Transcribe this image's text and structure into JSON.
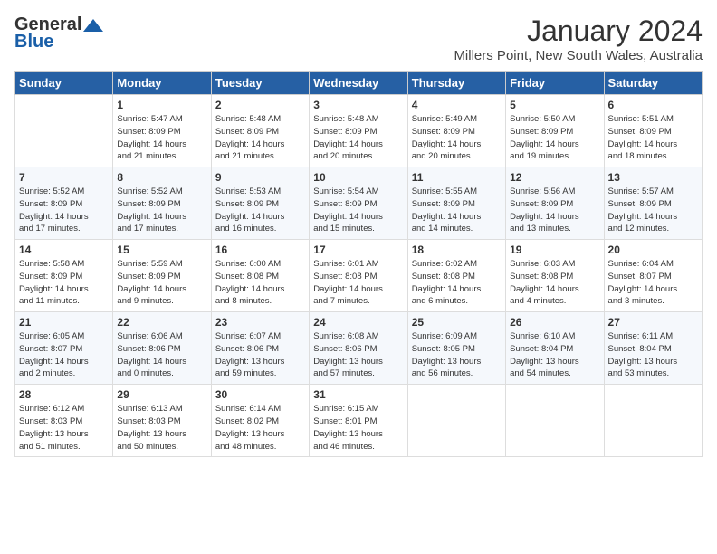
{
  "header": {
    "logo_general": "General",
    "logo_blue": "Blue",
    "title": "January 2024",
    "location": "Millers Point, New South Wales, Australia"
  },
  "days_of_week": [
    "Sunday",
    "Monday",
    "Tuesday",
    "Wednesday",
    "Thursday",
    "Friday",
    "Saturday"
  ],
  "weeks": [
    [
      {
        "num": "",
        "info": ""
      },
      {
        "num": "1",
        "info": "Sunrise: 5:47 AM\nSunset: 8:09 PM\nDaylight: 14 hours\nand 21 minutes."
      },
      {
        "num": "2",
        "info": "Sunrise: 5:48 AM\nSunset: 8:09 PM\nDaylight: 14 hours\nand 21 minutes."
      },
      {
        "num": "3",
        "info": "Sunrise: 5:48 AM\nSunset: 8:09 PM\nDaylight: 14 hours\nand 20 minutes."
      },
      {
        "num": "4",
        "info": "Sunrise: 5:49 AM\nSunset: 8:09 PM\nDaylight: 14 hours\nand 20 minutes."
      },
      {
        "num": "5",
        "info": "Sunrise: 5:50 AM\nSunset: 8:09 PM\nDaylight: 14 hours\nand 19 minutes."
      },
      {
        "num": "6",
        "info": "Sunrise: 5:51 AM\nSunset: 8:09 PM\nDaylight: 14 hours\nand 18 minutes."
      }
    ],
    [
      {
        "num": "7",
        "info": "Sunrise: 5:52 AM\nSunset: 8:09 PM\nDaylight: 14 hours\nand 17 minutes."
      },
      {
        "num": "8",
        "info": "Sunrise: 5:52 AM\nSunset: 8:09 PM\nDaylight: 14 hours\nand 17 minutes."
      },
      {
        "num": "9",
        "info": "Sunrise: 5:53 AM\nSunset: 8:09 PM\nDaylight: 14 hours\nand 16 minutes."
      },
      {
        "num": "10",
        "info": "Sunrise: 5:54 AM\nSunset: 8:09 PM\nDaylight: 14 hours\nand 15 minutes."
      },
      {
        "num": "11",
        "info": "Sunrise: 5:55 AM\nSunset: 8:09 PM\nDaylight: 14 hours\nand 14 minutes."
      },
      {
        "num": "12",
        "info": "Sunrise: 5:56 AM\nSunset: 8:09 PM\nDaylight: 14 hours\nand 13 minutes."
      },
      {
        "num": "13",
        "info": "Sunrise: 5:57 AM\nSunset: 8:09 PM\nDaylight: 14 hours\nand 12 minutes."
      }
    ],
    [
      {
        "num": "14",
        "info": "Sunrise: 5:58 AM\nSunset: 8:09 PM\nDaylight: 14 hours\nand 11 minutes."
      },
      {
        "num": "15",
        "info": "Sunrise: 5:59 AM\nSunset: 8:09 PM\nDaylight: 14 hours\nand 9 minutes."
      },
      {
        "num": "16",
        "info": "Sunrise: 6:00 AM\nSunset: 8:08 PM\nDaylight: 14 hours\nand 8 minutes."
      },
      {
        "num": "17",
        "info": "Sunrise: 6:01 AM\nSunset: 8:08 PM\nDaylight: 14 hours\nand 7 minutes."
      },
      {
        "num": "18",
        "info": "Sunrise: 6:02 AM\nSunset: 8:08 PM\nDaylight: 14 hours\nand 6 minutes."
      },
      {
        "num": "19",
        "info": "Sunrise: 6:03 AM\nSunset: 8:08 PM\nDaylight: 14 hours\nand 4 minutes."
      },
      {
        "num": "20",
        "info": "Sunrise: 6:04 AM\nSunset: 8:07 PM\nDaylight: 14 hours\nand 3 minutes."
      }
    ],
    [
      {
        "num": "21",
        "info": "Sunrise: 6:05 AM\nSunset: 8:07 PM\nDaylight: 14 hours\nand 2 minutes."
      },
      {
        "num": "22",
        "info": "Sunrise: 6:06 AM\nSunset: 8:06 PM\nDaylight: 14 hours\nand 0 minutes."
      },
      {
        "num": "23",
        "info": "Sunrise: 6:07 AM\nSunset: 8:06 PM\nDaylight: 13 hours\nand 59 minutes."
      },
      {
        "num": "24",
        "info": "Sunrise: 6:08 AM\nSunset: 8:06 PM\nDaylight: 13 hours\nand 57 minutes."
      },
      {
        "num": "25",
        "info": "Sunrise: 6:09 AM\nSunset: 8:05 PM\nDaylight: 13 hours\nand 56 minutes."
      },
      {
        "num": "26",
        "info": "Sunrise: 6:10 AM\nSunset: 8:04 PM\nDaylight: 13 hours\nand 54 minutes."
      },
      {
        "num": "27",
        "info": "Sunrise: 6:11 AM\nSunset: 8:04 PM\nDaylight: 13 hours\nand 53 minutes."
      }
    ],
    [
      {
        "num": "28",
        "info": "Sunrise: 6:12 AM\nSunset: 8:03 PM\nDaylight: 13 hours\nand 51 minutes."
      },
      {
        "num": "29",
        "info": "Sunrise: 6:13 AM\nSunset: 8:03 PM\nDaylight: 13 hours\nand 50 minutes."
      },
      {
        "num": "30",
        "info": "Sunrise: 6:14 AM\nSunset: 8:02 PM\nDaylight: 13 hours\nand 48 minutes."
      },
      {
        "num": "31",
        "info": "Sunrise: 6:15 AM\nSunset: 8:01 PM\nDaylight: 13 hours\nand 46 minutes."
      },
      {
        "num": "",
        "info": ""
      },
      {
        "num": "",
        "info": ""
      },
      {
        "num": "",
        "info": ""
      }
    ]
  ]
}
